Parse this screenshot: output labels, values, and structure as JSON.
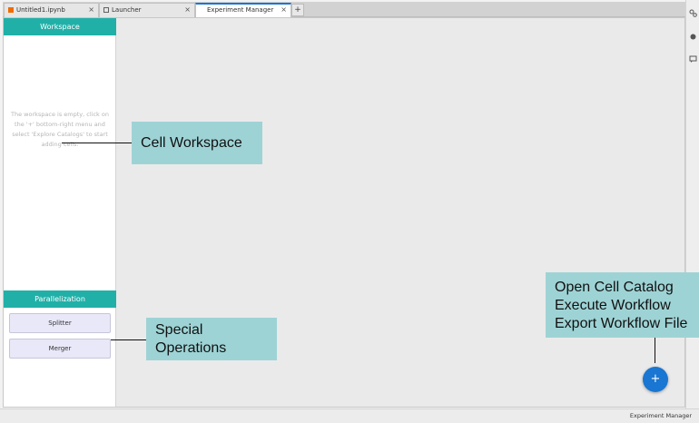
{
  "tabs": [
    {
      "label": "Untitled1.ipynb",
      "icon": "notebook-icon",
      "icon_color": "#ef6c00"
    },
    {
      "label": "Launcher",
      "icon": "launcher-icon",
      "icon_color": "#616161"
    },
    {
      "label": "Experiment Manager",
      "active": true
    }
  ],
  "tab_close_glyph": "×",
  "tab_add_glyph": "+",
  "workspace": {
    "header": "Workspace",
    "empty_message": "The workspace is empty, click on the '+' bottom-right menu and select 'Explore Catalogs' to start adding cells."
  },
  "parallelization": {
    "header": "Parallelization",
    "buttons": [
      "Splitter",
      "Merger"
    ]
  },
  "fab_label": "+",
  "status_bar": {
    "text": "Experiment Manager"
  },
  "annotations": {
    "cell_workspace": "Cell Workspace",
    "special_operations": [
      "Special",
      "Operations"
    ],
    "fab_menu": [
      "Open Cell Catalog",
      "Execute Workflow",
      "Export Workflow File"
    ]
  },
  "colors": {
    "accent": "#21b0a8",
    "primary": "#1976d2",
    "callout": "#9ed3d5",
    "button_bg": "#e8e8f8"
  }
}
